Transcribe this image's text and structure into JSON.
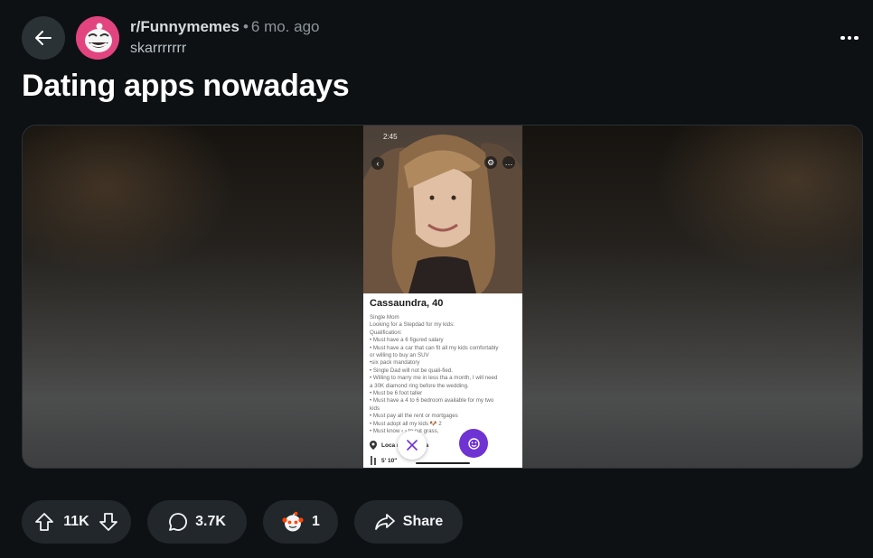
{
  "header": {
    "subreddit": "r/Funnymemes",
    "separator": "•",
    "time_ago": "6 mo. ago",
    "author": "skarrrrrrr"
  },
  "post": {
    "title": "Dating apps nowadays"
  },
  "media": {
    "profile_name": "Cassaundra, 40",
    "status_time": "2:45",
    "bio_lines": [
      "Single Mom",
      "Looking for a Stepdad for my kids:",
      "Qualification:",
      "• Must have a 6 figured salary",
      "• Must have a car that can fit all my kids comfortably",
      "or willing to buy an SUV",
      "•six pack mandatory",
      "• Single Dad will not be quali-fied.",
      "• Willing to marry me in less tha a month, I will need",
      "a 30K diamond ring before the wedding.",
      "• Must be 6 foot taller",
      "• Must have a 4 to 6 bedroom available for my two",
      "kids",
      "• Must pay all the rent or mortgages",
      "• Must adopt all my kids 🐶 2",
      "• Must know ‹ › to cut grass,"
    ],
    "location_text": "Loca        ria, Arizona",
    "height_text": "5' 10\""
  },
  "actions": {
    "upvotes": "11K",
    "comments": "3.7K",
    "awards": "1",
    "share_label": "Share"
  },
  "colors": {
    "background": "#0e1113",
    "pill": "#21272a",
    "accent_purple": "#6f33d4",
    "avatar_pink": "#e1447f"
  },
  "icons": {
    "back": "arrow-left-icon",
    "more": "more-horizontal-icon",
    "upvote": "upvote-arrow-icon",
    "downvote": "downvote-arrow-icon",
    "comment": "speech-bubble-icon",
    "award": "snoo-award-icon",
    "share": "share-arrow-icon"
  }
}
